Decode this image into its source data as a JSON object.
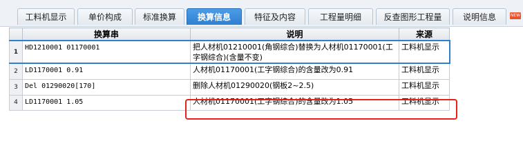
{
  "tabs": [
    {
      "label": "工料机显示",
      "active": false
    },
    {
      "label": "单价构成",
      "active": false
    },
    {
      "label": "标准换算",
      "active": false
    },
    {
      "label": "换算信息",
      "active": true
    },
    {
      "label": "特征及内容",
      "active": false
    },
    {
      "label": "工程量明细",
      "active": false
    },
    {
      "label": "反查图形工程量",
      "active": false
    },
    {
      "label": "说明信息",
      "active": false
    }
  ],
  "new_badge": "NEW",
  "table": {
    "columns": [
      "换算串",
      "说明",
      "来源"
    ],
    "rows": [
      {
        "index": "1",
        "code": "HD1210001 01170001",
        "desc": "把人材机01210001(角钢综合)替换为人材机01170001(工字钢综合)(含量不变)",
        "source": "工料机显示",
        "selected": true
      },
      {
        "index": "2",
        "code": "LD1170001 0.91",
        "desc": "人材机01170001(工字钢综合)的含量改为0.91",
        "source": "工料机显示",
        "selected": false
      },
      {
        "index": "3",
        "code": "Del 01290020[170]",
        "desc": "删除人材机01290020(钢板2~2.5)",
        "source": "工料机显示",
        "selected": false
      },
      {
        "index": "4",
        "code": "LD1170001 1.05",
        "desc": "人材机01170001(工字钢综合)的含量改为1.05",
        "source": "工料机显示",
        "selected": false
      }
    ]
  },
  "colors": {
    "active_tab": "#2f7fd1",
    "highlight": "#e8201a"
  }
}
